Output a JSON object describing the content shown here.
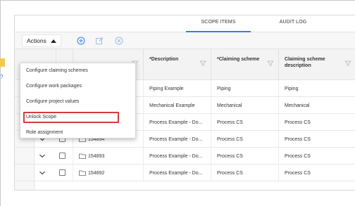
{
  "tabs": {
    "scope_items": "SCOPE ITEMS",
    "audit_log": "AUDIT LOG"
  },
  "toolbar": {
    "actions_label": "Actions",
    "icons": [
      "add-circle-icon",
      "edit-icon",
      "cancel-circle-icon"
    ]
  },
  "actions_menu": {
    "items": [
      "Configure claiming schemes",
      "Configure work packages",
      "Configure project values",
      "Unlock Scope",
      "Role assignment"
    ],
    "highlight_color": "#d63a3a"
  },
  "table": {
    "columns": [
      "*Description",
      "*Claiming scheme",
      "Claiming scheme description"
    ],
    "rows": [
      {
        "id": "",
        "description": "Piping Example",
        "claiming_scheme": "Piping",
        "scheme_description": "Piping"
      },
      {
        "id": "",
        "description": "Mechanical Example",
        "claiming_scheme": "Mechanical",
        "scheme_description": "Mechanical"
      },
      {
        "id": "",
        "description": "Process Example - Do...",
        "claiming_scheme": "Process CS",
        "scheme_description": "Process CS"
      },
      {
        "id": "154894",
        "description": "Process Example - Do...",
        "claiming_scheme": "Process CS",
        "scheme_description": "Process CS"
      },
      {
        "id": "154893",
        "description": "Process Example - Do...",
        "claiming_scheme": "Process CS",
        "scheme_description": "Process CS"
      },
      {
        "id": "154892",
        "description": "Process Example - Do...",
        "claiming_scheme": "Process CS",
        "scheme_description": "Process CS"
      }
    ]
  },
  "colors": {
    "tab_accent": "#2f80ed",
    "icon_blue": "#2f80ed"
  }
}
